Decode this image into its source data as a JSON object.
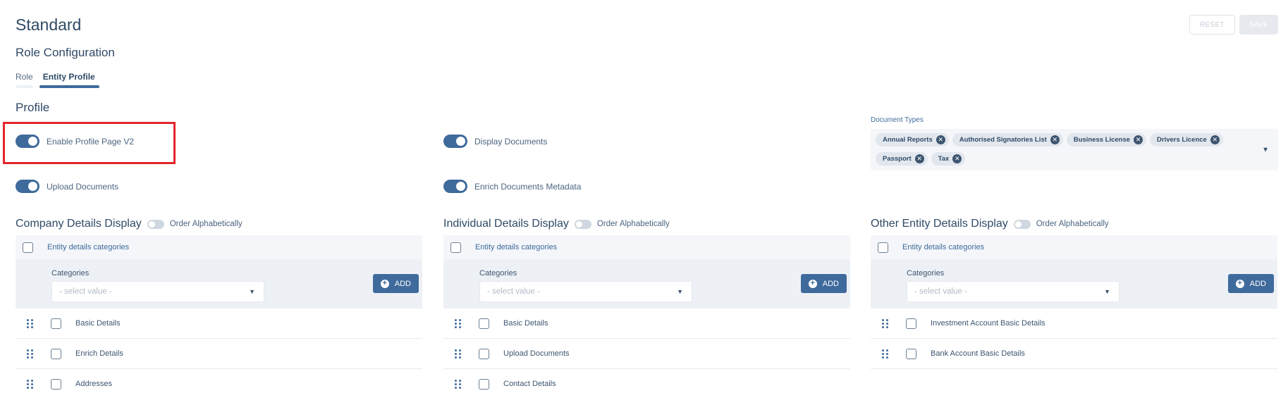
{
  "header": {
    "title": "Standard",
    "reset_label": "RESET",
    "save_label": "SAVE"
  },
  "section_title": "Role Configuration",
  "tabs": [
    {
      "label": "Role",
      "active": false
    },
    {
      "label": "Entity Profile",
      "active": true
    }
  ],
  "profile": {
    "title": "Profile",
    "toggles": {
      "enable_profile_v2": {
        "label": "Enable Profile Page V2",
        "on": true
      },
      "display_documents": {
        "label": "Display Documents",
        "on": true
      },
      "upload_documents": {
        "label": "Upload Documents",
        "on": true
      },
      "enrich_documents_metadata": {
        "label": "Enrich Documents Metadata",
        "on": true
      }
    },
    "document_types": {
      "label": "Document Types",
      "chips": [
        "Annual Reports",
        "Authorised Signatories List",
        "Business License",
        "Drivers Licence",
        "Passport",
        "Tax"
      ]
    }
  },
  "columns": [
    {
      "title": "Company Details Display",
      "order_label": "Order Alphabetically",
      "header_label": "Entity details categories",
      "categories_label": "Categories",
      "select_placeholder": "- select value -",
      "add_label": "ADD",
      "items": [
        "Basic Details",
        "Enrich Details",
        "Addresses"
      ]
    },
    {
      "title": "Individual Details Display",
      "order_label": "Order Alphabetically",
      "header_label": "Entity details categories",
      "categories_label": "Categories",
      "select_placeholder": "- select value -",
      "add_label": "ADD",
      "items": [
        "Basic Details",
        "Upload Documents",
        "Contact Details"
      ]
    },
    {
      "title": "Other Entity Details Display",
      "order_label": "Order Alphabetically",
      "header_label": "Entity details categories",
      "categories_label": "Categories",
      "select_placeholder": "- select value -",
      "add_label": "ADD",
      "items": [
        "Investment Account Basic Details",
        "Bank Account Basic Details"
      ]
    }
  ],
  "colors": {
    "accent": "#3f6a9c",
    "highlight": "#e3262d",
    "text": "#2f4a66"
  }
}
